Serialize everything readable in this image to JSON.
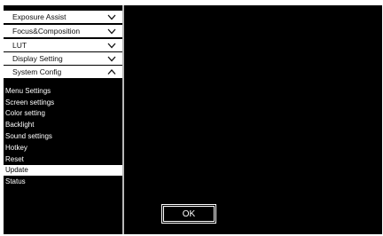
{
  "sidebar": {
    "menus": [
      {
        "label": "Exposure Assist",
        "chevron": "chevron-down-icon"
      },
      {
        "label": "Focus&Composition",
        "chevron": "chevron-down-icon"
      },
      {
        "label": "LUT",
        "chevron": "chevron-down-icon"
      },
      {
        "label": "Display Setting",
        "chevron": "chevron-down-icon"
      },
      {
        "label": "System Config",
        "chevron": "chevron-up-icon",
        "expanded": true
      }
    ],
    "system_config_items": [
      {
        "label": "Menu Settings"
      },
      {
        "label": "Screen settings"
      },
      {
        "label": "Color setting"
      },
      {
        "label": "Backlight"
      },
      {
        "label": "Sound settings"
      },
      {
        "label": "Hotkey"
      },
      {
        "label": "Reset"
      },
      {
        "label": "Update",
        "selected": true
      },
      {
        "label": "Status"
      }
    ]
  },
  "main": {
    "ok_label": "OK"
  },
  "colors": {
    "background": "#000000",
    "header_bg": "#ffffff",
    "selected_bg": "#ffffff",
    "divider": "#b8b8b8"
  }
}
